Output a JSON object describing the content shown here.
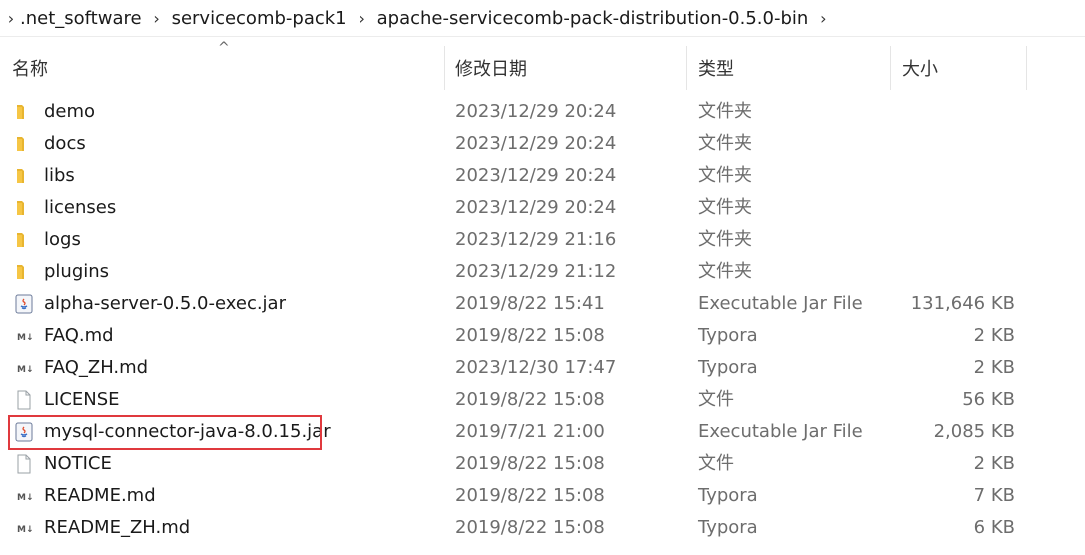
{
  "breadcrumb": [
    ".net_software",
    "servicecomb-pack1",
    "apache-servicecomb-pack-distribution-0.5.0-bin"
  ],
  "columns": {
    "name": "名称",
    "date": "修改日期",
    "type": "类型",
    "size": "大小",
    "sort_arrow": "^"
  },
  "files": [
    {
      "name": "demo",
      "date": "2023/12/29 20:24",
      "type": "文件夹",
      "size": "",
      "icon": "folder-icon"
    },
    {
      "name": "docs",
      "date": "2023/12/29 20:24",
      "type": "文件夹",
      "size": "",
      "icon": "folder-icon"
    },
    {
      "name": "libs",
      "date": "2023/12/29 20:24",
      "type": "文件夹",
      "size": "",
      "icon": "folder-icon"
    },
    {
      "name": "licenses",
      "date": "2023/12/29 20:24",
      "type": "文件夹",
      "size": "",
      "icon": "folder-icon"
    },
    {
      "name": "logs",
      "date": "2023/12/29 21:16",
      "type": "文件夹",
      "size": "",
      "icon": "folder-icon"
    },
    {
      "name": "plugins",
      "date": "2023/12/29 21:12",
      "type": "文件夹",
      "size": "",
      "icon": "folder-icon"
    },
    {
      "name": "alpha-server-0.5.0-exec.jar",
      "date": "2019/8/22 15:41",
      "type": "Executable Jar File",
      "size": "131,646 KB",
      "icon": "java-jar-icon"
    },
    {
      "name": "FAQ.md",
      "date": "2019/8/22 15:08",
      "type": "Typora",
      "size": "2 KB",
      "icon": "markdown-file-icon"
    },
    {
      "name": "FAQ_ZH.md",
      "date": "2023/12/30 17:47",
      "type": "Typora",
      "size": "2 KB",
      "icon": "markdown-file-icon"
    },
    {
      "name": "LICENSE",
      "date": "2019/8/22 15:08",
      "type": "文件",
      "size": "56 KB",
      "icon": "blank-file-icon"
    },
    {
      "name": "mysql-connector-java-8.0.15.jar",
      "date": "2019/7/21 21:00",
      "type": "Executable Jar File",
      "size": "2,085 KB",
      "icon": "java-jar-icon",
      "highlighted": true
    },
    {
      "name": "NOTICE",
      "date": "2019/8/22 15:08",
      "type": "文件",
      "size": "2 KB",
      "icon": "blank-file-icon"
    },
    {
      "name": "README.md",
      "date": "2019/8/22 15:08",
      "type": "Typora",
      "size": "7 KB",
      "icon": "markdown-file-icon"
    },
    {
      "name": "README_ZH.md",
      "date": "2019/8/22 15:08",
      "type": "Typora",
      "size": "6 KB",
      "icon": "markdown-file-icon"
    }
  ],
  "colors": {
    "folder": "#f6c645",
    "highlight_border": "#e0393e",
    "secondary_text": "#6d6d6d"
  }
}
